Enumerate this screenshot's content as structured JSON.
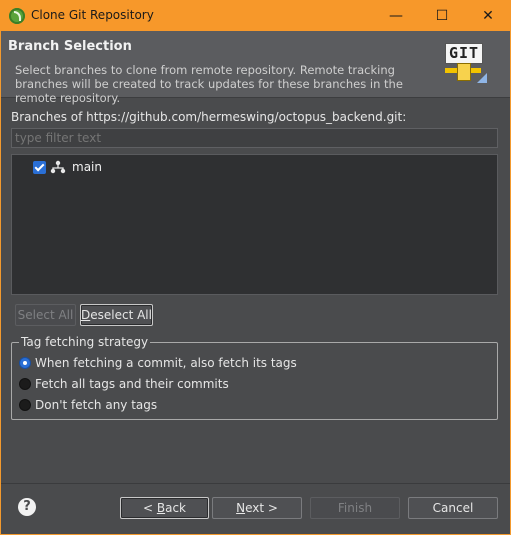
{
  "window": {
    "title": "Clone Git Repository",
    "controls": {
      "minimize": "—",
      "maximize": "☐",
      "close": "✕"
    }
  },
  "header": {
    "title": "Branch Selection",
    "description": "Select branches to clone from remote repository. Remote tracking branches will be created to track updates for these branches in the remote repository.",
    "logo_text": "GIT"
  },
  "branches": {
    "label": "Branches of https://github.com/hermeswing/octopus_backend.git:",
    "filter_placeholder": "type filter text",
    "items": [
      {
        "label": "main",
        "checked": true,
        "icon": "branch-icon"
      }
    ]
  },
  "selection_buttons": {
    "select_all": "Select All",
    "deselect_all_mnemonic": "D",
    "deselect_all_rest": "eselect All"
  },
  "tag_strategy": {
    "legend": "Tag fetching strategy",
    "options": [
      {
        "label": "When fetching a commit, also fetch its tags",
        "selected": true
      },
      {
        "label": "Fetch all tags and their commits",
        "selected": false
      },
      {
        "label": "Don't fetch any tags",
        "selected": false
      }
    ]
  },
  "footer": {
    "back_prefix": "< ",
    "back_mnemonic": "B",
    "back_rest": "ack",
    "next_mnemonic": "N",
    "next_rest": "ext >",
    "finish": "Finish",
    "cancel": "Cancel",
    "help_icon": "?"
  },
  "colors": {
    "titlebar": "#f7982a",
    "accent": "#2a6fd6",
    "background": "#4a4b4d"
  }
}
